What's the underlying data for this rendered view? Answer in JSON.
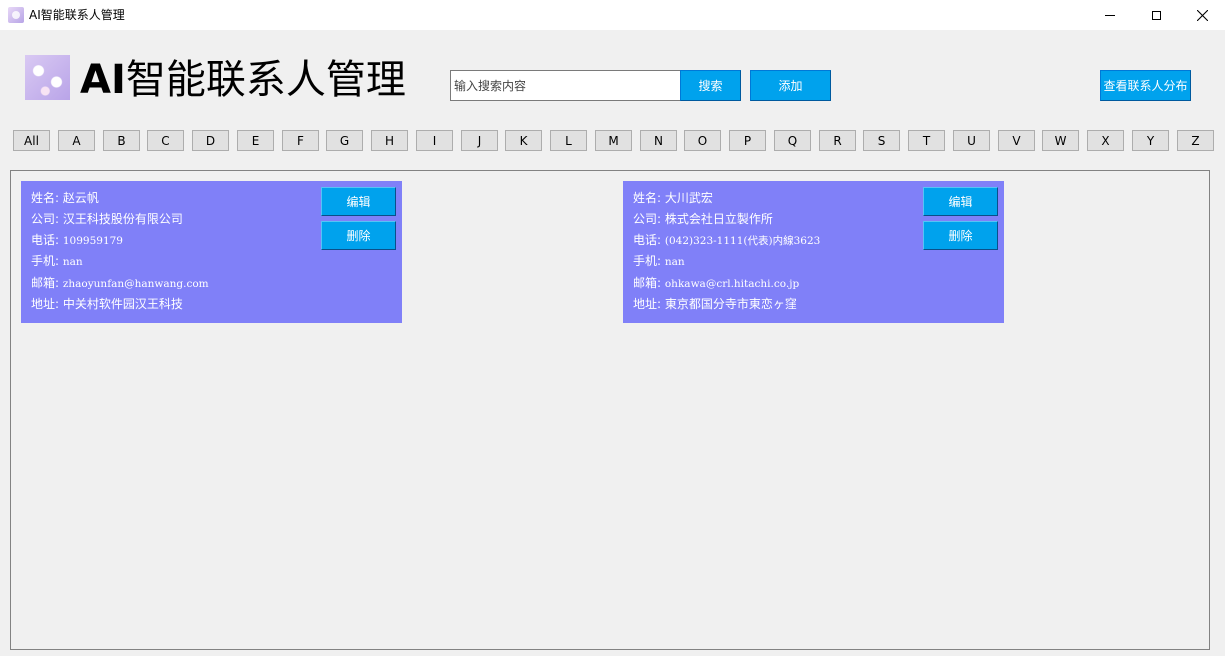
{
  "window": {
    "title": "AI智能联系人管理"
  },
  "header": {
    "title_ai": "AI",
    "title_rest": "智能联系人管理",
    "search_placeholder": "输入搜索内容",
    "search_label": "搜索",
    "add_label": "添加",
    "distribution_label": "查看联系人分布"
  },
  "letters": [
    "All",
    "A",
    "B",
    "C",
    "D",
    "E",
    "F",
    "G",
    "H",
    "I",
    "J",
    "K",
    "L",
    "M",
    "N",
    "O",
    "P",
    "Q",
    "R",
    "S",
    "T",
    "U",
    "V",
    "W",
    "X",
    "Y",
    "Z"
  ],
  "card_labels": {
    "edit": "编辑",
    "delete": "删除"
  },
  "contacts": [
    {
      "name": "姓名: 赵云帆",
      "company": "公司: 汉王科技股份有限公司",
      "phone_label": "电话: ",
      "phone": "109959179",
      "mobile_label": "手机: ",
      "mobile": "nan",
      "email_label": "邮箱: ",
      "email": "zhaoyunfan@hanwang.com",
      "address": "地址: 中关村软件园汉王科技"
    },
    {
      "name": "姓名: 大川武宏",
      "company": "公司: 株式会社日立製作所",
      "phone_label": "电话: ",
      "phone": "(042)323-1111(代表)内線3623",
      "mobile_label": "手机: ",
      "mobile": "nan",
      "email_label": "邮箱: ",
      "email": "ohkawa@crl.hitachi.co.jp",
      "address": "地址: 東京都国分寺市東恋ヶ窪"
    }
  ],
  "colors": {
    "accent": "#00a2ed",
    "card": "#8080f8",
    "background": "#f0f0f0"
  }
}
